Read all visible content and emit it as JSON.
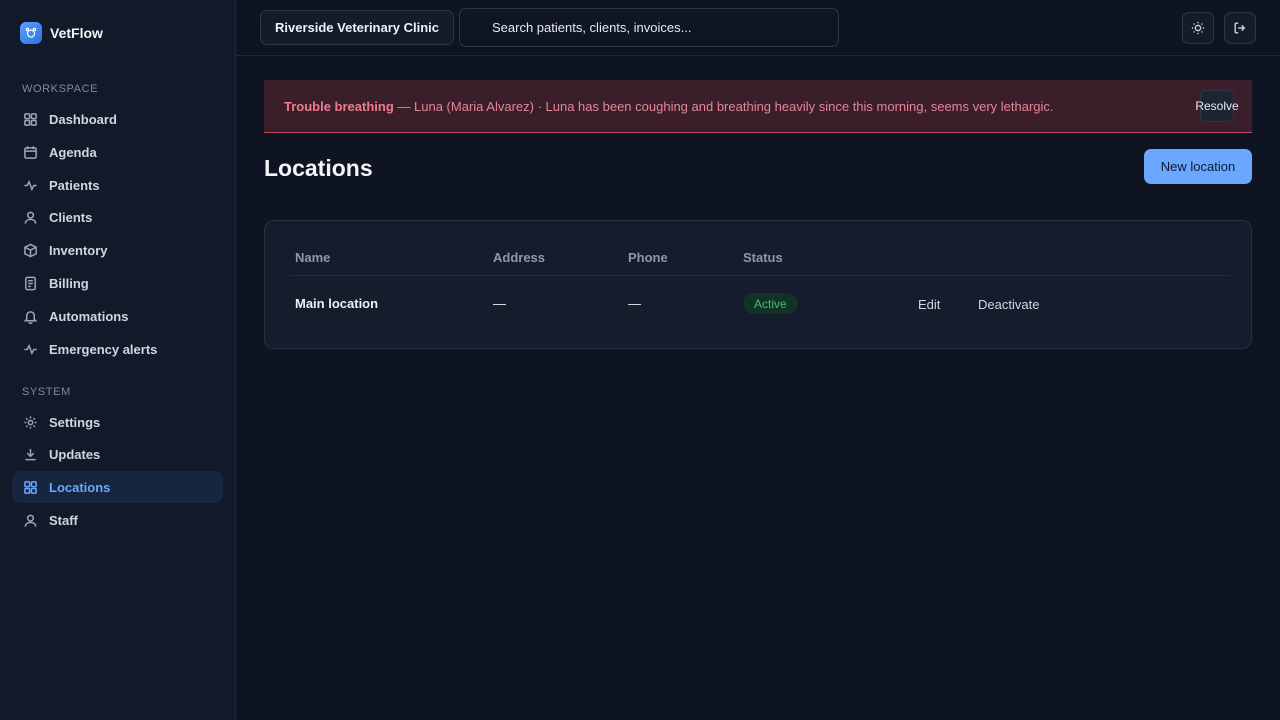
{
  "app": {
    "name": "VetFlow"
  },
  "sidebar": {
    "sections": [
      {
        "label": "WORKSPACE",
        "items": [
          {
            "label": "Dashboard",
            "icon": "grid-icon"
          },
          {
            "label": "Agenda",
            "icon": "calendar-icon"
          },
          {
            "label": "Patients",
            "icon": "activity-icon"
          },
          {
            "label": "Clients",
            "icon": "user-icon"
          },
          {
            "label": "Inventory",
            "icon": "box-icon"
          },
          {
            "label": "Billing",
            "icon": "receipt-icon"
          },
          {
            "label": "Automations",
            "icon": "bell-icon"
          },
          {
            "label": "Emergency alerts",
            "icon": "activity-icon"
          }
        ]
      },
      {
        "label": "SYSTEM",
        "items": [
          {
            "label": "Settings",
            "icon": "gear-icon"
          },
          {
            "label": "Updates",
            "icon": "download-icon"
          },
          {
            "label": "Locations",
            "icon": "grid-icon",
            "active": true
          },
          {
            "label": "Staff",
            "icon": "user-icon"
          }
        ]
      }
    ]
  },
  "topbar": {
    "clinic": "Riverside Veterinary Clinic",
    "search_placeholder": "Search patients, clients, invoices...",
    "theme_icon": "sun-icon",
    "logout_icon": "logout-icon"
  },
  "alert": {
    "title": "Trouble breathing",
    "message": " — Luna (Maria Alvarez) · Luna has been coughing and breathing heavily since this morning, seems very lethargic.",
    "resolve_label": "Resolve"
  },
  "page": {
    "title": "Locations",
    "new_button": "New location"
  },
  "table": {
    "columns": [
      "Name",
      "Address",
      "Phone",
      "Status"
    ],
    "rows": [
      {
        "name": "Main location",
        "address": "—",
        "phone": "—",
        "status": "Active",
        "actions": [
          "Edit",
          "Deactivate"
        ]
      }
    ]
  },
  "colors": {
    "accent": "#6aa8ff",
    "alert_bg": "#3a1e2a",
    "alert_text": "#f07a90",
    "status_active": "#3fbf6a"
  }
}
